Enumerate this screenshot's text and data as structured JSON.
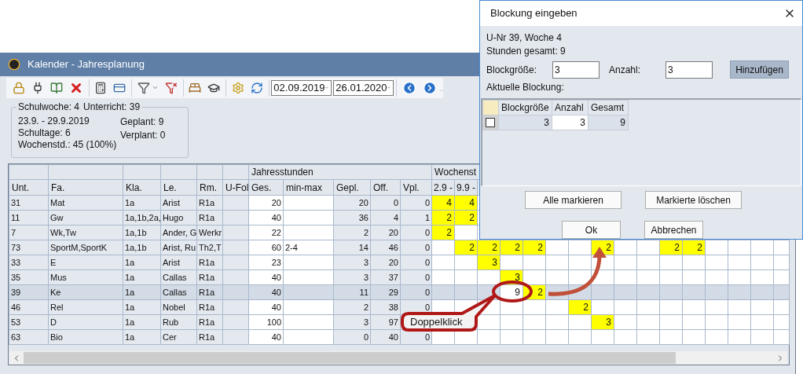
{
  "window": {
    "title": "Kalender - Jahresplanung"
  },
  "toolbar": {
    "date_from": "02.09.2019",
    "date_to": "26.01.2020"
  },
  "week_info": {
    "legend": [
      "Schulwoche: 4",
      "Unterricht: 39"
    ],
    "left": [
      "23.9. - 29.9.2019",
      "Schultage: 6",
      "Wochenstd.: 45 (100%)"
    ],
    "right": [
      "Geplant: 9",
      "Verplant: 0"
    ]
  },
  "grid": {
    "group_headers": [
      "Jahresstunden",
      "Wochenst"
    ],
    "columns": [
      "Unt.",
      "Fa.",
      "Kla.",
      "Le.",
      "Rm.",
      "U-Fol",
      "Ges.",
      "min-max",
      "Gepl.",
      "Off.",
      "Vpl."
    ],
    "week_columns": [
      "2.9 -",
      "9.9 -"
    ],
    "rows": [
      {
        "selected": false,
        "unt": "31",
        "fa": "Mat",
        "kla": "1a",
        "le": "Arist",
        "rm": "R1a",
        "ges": "20",
        "gepl": "20",
        "off": "0",
        "vpl": "0",
        "weeks": [
          {
            "kind": "entry",
            "value": "4",
            "selected": false
          },
          {
            "kind": "entry",
            "value": "4",
            "selected": false
          }
        ]
      },
      {
        "selected": false,
        "unt": "11",
        "fa": "Gw",
        "kla": "1a,1b,2a,",
        "le": "Hugo",
        "rm": "R1a",
        "ges": "40",
        "gepl": "36",
        "off": "4",
        "vpl": "1",
        "weeks": [
          {
            "kind": "entry",
            "value": "2",
            "selected": false
          },
          {
            "kind": "entry",
            "value": "2",
            "selected": false
          }
        ]
      },
      {
        "selected": false,
        "unt": "7",
        "fa": "Wk,Tw",
        "kla": "1a,1b",
        "le": "Ander, G",
        "rm": "Werkr",
        "ges": "22",
        "gepl": "2",
        "off": "20",
        "vpl": "0",
        "weeks": [
          {
            "kind": "entry",
            "value": "2",
            "selected": false
          },
          {
            "kind": "empty"
          }
        ]
      },
      {
        "selected": false,
        "unt": "73",
        "fa": "SportM,SportK",
        "kla": "1a,1b",
        "le": "Arist, Ru",
        "rm": "Th2,T",
        "ges": "60",
        "min_max": "2-4",
        "gepl": "14",
        "off": "46",
        "vpl": "0",
        "weeks": [
          {
            "kind": "empty"
          },
          {
            "kind": "entry",
            "value": "2",
            "selected": false
          },
          {
            "kind": "entry",
            "value": "2",
            "selected": false
          },
          {
            "kind": "entry",
            "value": "2",
            "selected": false
          },
          {
            "kind": "entry",
            "value": "2",
            "selected": false
          },
          {
            "kind": "empty"
          },
          {
            "kind": "empty"
          },
          {
            "kind": "entry",
            "value": "2",
            "selected": false
          },
          {
            "kind": "empty"
          },
          {
            "kind": "empty"
          },
          {
            "kind": "entry",
            "value": "2",
            "selected": false
          },
          {
            "kind": "entry",
            "value": "2",
            "selected": false
          }
        ]
      },
      {
        "selected": false,
        "unt": "33",
        "fa": "E",
        "kla": "1a",
        "le": "Arist",
        "rm": "R1a",
        "ges": "23",
        "gepl": "3",
        "off": "20",
        "vpl": "0",
        "weeks": [
          {
            "kind": "empty"
          },
          {
            "kind": "empty"
          },
          {
            "kind": "entry",
            "value": "3",
            "selected": false
          }
        ]
      },
      {
        "selected": false,
        "unt": "35",
        "fa": "Mus",
        "kla": "1a",
        "le": "Callas",
        "rm": "R1a",
        "ges": "40",
        "gepl": "3",
        "off": "37",
        "vpl": "0",
        "weeks": [
          {
            "kind": "empty"
          },
          {
            "kind": "empty"
          },
          {
            "kind": "empty"
          },
          {
            "kind": "entry",
            "value": "3",
            "selected": false
          }
        ]
      },
      {
        "selected": true,
        "unt": "39",
        "fa": "Ke",
        "kla": "1a",
        "le": "Callas",
        "rm": "R1a",
        "ges": "40",
        "gepl": "11",
        "off": "29",
        "vpl": "0",
        "weeks": [
          {
            "kind": "empty"
          },
          {
            "kind": "empty"
          },
          {
            "kind": "empty"
          },
          {
            "kind": "entry",
            "value": "9",
            "selected": true
          },
          {
            "kind": "entry",
            "value": "2",
            "selected": false
          }
        ]
      },
      {
        "selected": false,
        "unt": "46",
        "fa": "Rel",
        "kla": "1a",
        "le": "Nobel",
        "rm": "R1a",
        "ges": "40",
        "gepl": "2",
        "off": "38",
        "vpl": "0",
        "weeks": [
          {
            "kind": "empty"
          },
          {
            "kind": "empty"
          },
          {
            "kind": "empty"
          },
          {
            "kind": "empty"
          },
          {
            "kind": "empty"
          },
          {
            "kind": "empty"
          },
          {
            "kind": "entry",
            "value": "2",
            "selected": false
          }
        ]
      },
      {
        "selected": false,
        "unt": "53",
        "fa": "D",
        "kla": "1a",
        "le": "Rub",
        "rm": "R1a",
        "ges": "100",
        "gepl": "3",
        "off": "97",
        "weeks": [
          {
            "kind": "empty"
          },
          {
            "kind": "empty"
          },
          {
            "kind": "empty"
          },
          {
            "kind": "empty"
          },
          {
            "kind": "empty"
          },
          {
            "kind": "empty"
          },
          {
            "kind": "empty"
          },
          {
            "kind": "entry",
            "value": "3",
            "selected": false
          }
        ]
      },
      {
        "selected": false,
        "unt": "63",
        "fa": "Bio",
        "kla": "1a",
        "le": "Cer",
        "rm": "R1a",
        "ges": "40",
        "gepl": "0",
        "off": "40",
        "vpl": "0"
      }
    ]
  },
  "dialog": {
    "title": "Blockung eingeben",
    "info": [
      "U-Nr 39, Woche 4",
      "Stunden gesamt: 9"
    ],
    "block_size": {
      "label": "Blockgröße:",
      "value": "3"
    },
    "count": {
      "label": "Anzahl:",
      "value": "3"
    },
    "add_button": {
      "label": "Hinzufügen",
      "highlighted": true
    },
    "current_label": "Aktuelle Blockung:",
    "table": {
      "columns": [
        "Blockgröße",
        "Anzahl",
        "Gesamt"
      ],
      "rows": [
        {
          "checked": false,
          "cells": [
            "3",
            "3",
            "9"
          ]
        }
      ]
    },
    "buttons": [
      "Alle markieren",
      "Markierte löschen"
    ],
    "footer_buttons": [
      "Ok",
      "Abbrechen"
    ]
  },
  "annotation": {
    "callout": "Doppelklick"
  }
}
